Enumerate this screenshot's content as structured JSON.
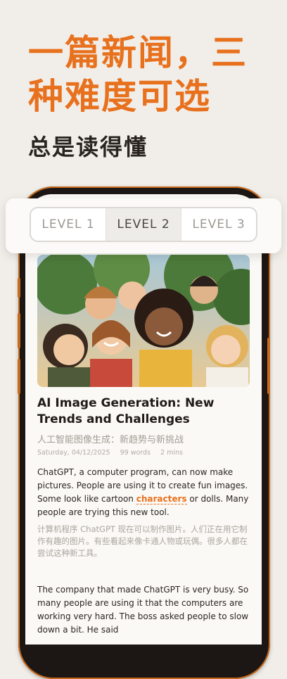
{
  "hero": {
    "title": "一篇新闻，三种难度可选",
    "subtitle": "总是读得懂"
  },
  "levels": {
    "items": [
      "LEVEL 1",
      "LEVEL 2",
      "LEVEL 3"
    ],
    "selected": "LEVEL 2"
  },
  "article": {
    "image_icon": "cartoon-group-photo",
    "title": "AI Image Generation: New Trends and Challenges",
    "subtitle_zh": "人工智能图像生成：新趋势与新挑战",
    "date": "Saturday, 04/12/2025",
    "word_count": "99 words",
    "read_time": "2 mins",
    "paragraphs": [
      {
        "en_before": "ChatGPT, a computer program, can now make pictures. People are using it to create fun images. Some look like cartoon ",
        "en_vocab": "characters",
        "en_after": " or dolls. Many people are trying this new tool.",
        "zh": "计算机程序 ChatGPT 现在可以制作图片。人们正在用它制作有趣的图片。有些看起来像卡通人物或玩偶。很多人都在尝试这种新工具。"
      },
      {
        "en": "The company that made ChatGPT is very busy. So many people are using it that the computers are working very hard. The boss asked people to slow down a bit. He said"
      }
    ]
  },
  "colors": {
    "accent": "#e8711e",
    "background": "#f1eee9",
    "phone_frame": "#1c1714"
  }
}
